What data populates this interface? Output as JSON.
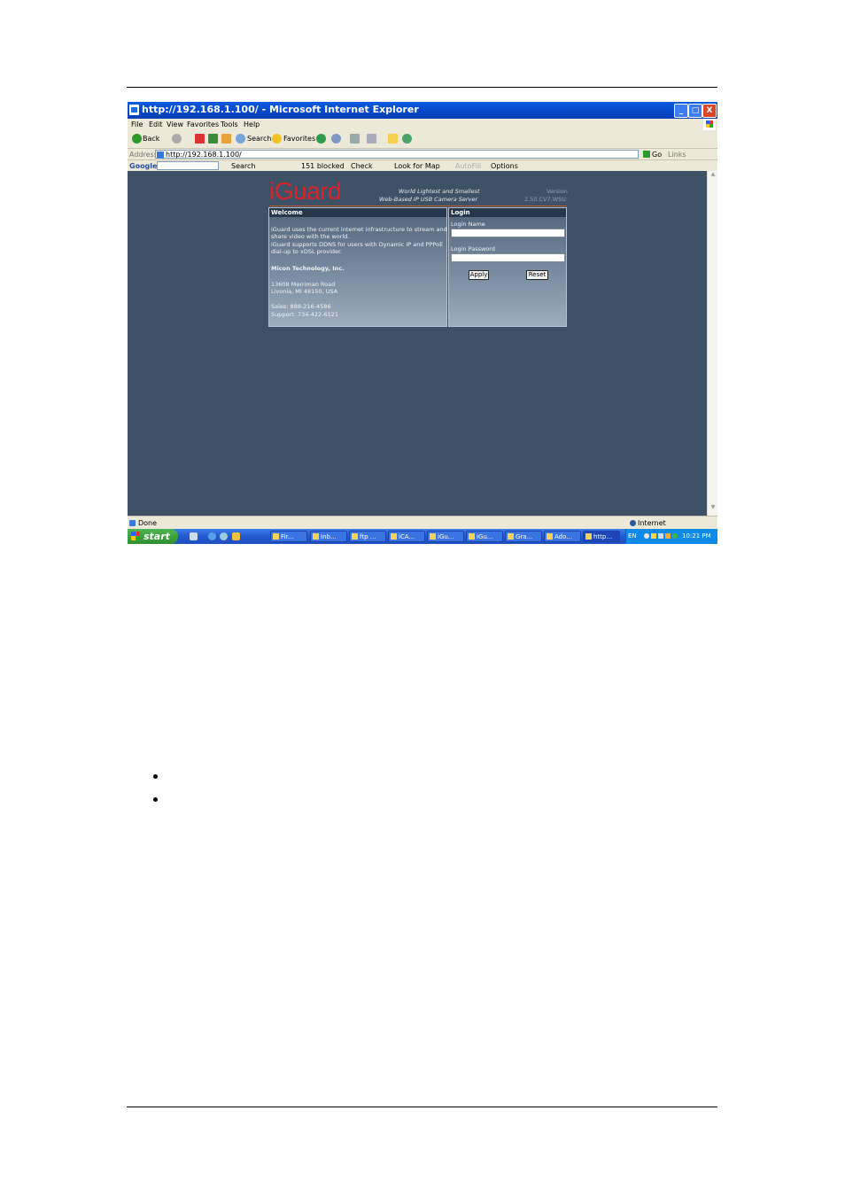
{
  "window": {
    "title": "http://192.168.1.100/ - Microsoft Internet Explorer",
    "minimize": "_",
    "maximize": "□",
    "close": "X"
  },
  "menu": [
    "File",
    "Edit",
    "View",
    "Favorites",
    "Tools",
    "Help"
  ],
  "toolbar": {
    "back": "Back",
    "search": "Search",
    "favorites": "Favorites"
  },
  "address": {
    "label": "Address",
    "url": "http://192.168.1.100/",
    "go": "Go",
    "links": "Links"
  },
  "googlebar": {
    "brand": "Google",
    "search": "Search",
    "blocked": "151 blocked",
    "check": "Check",
    "lookup": "Look for Map",
    "autofill": "AutoFill",
    "options": "Options"
  },
  "page": {
    "logo": "iGuard",
    "tagline1": "World Lightest and Smallest",
    "tagline2": "Web-Based IP USB Camera Server",
    "version_label": "Version",
    "version": "2.50.CV7.WSU",
    "welcome": {
      "heading": "Welcome",
      "line1": "iGuard uses the current internet infrastructure to stream and",
      "line2": "share video with the world.",
      "line3": "iGuard supports DDNS for users with Dynamic IP and PPPoE",
      "line4": "dial-up to xDSL provider.",
      "company": "Micon Technology, Inc.",
      "address1": "13608 Merriman Road",
      "address2": "Livonia, MI 48150, USA",
      "sales": "Sales: 888-216-4586",
      "support": "Support: 734-422-6121"
    },
    "login": {
      "heading": "Login",
      "name_label": "Login Name",
      "password_label": "Login Password",
      "apply": "Apply",
      "reset": "Reset"
    }
  },
  "status": {
    "text": "Done",
    "zone": "Internet"
  },
  "taskbar": {
    "start": "start",
    "tasks": [
      "Fir...",
      "Inb...",
      "ftp ...",
      "iCA...",
      "iGu...",
      "iGu...",
      "Gra...",
      "Ado...",
      "http..."
    ],
    "lang": "EN",
    "clock": "10:21 PM"
  },
  "colors": {
    "page_bg": "#3f5166",
    "logo": "#d9232a",
    "titlebar": "#0a5ce0"
  }
}
